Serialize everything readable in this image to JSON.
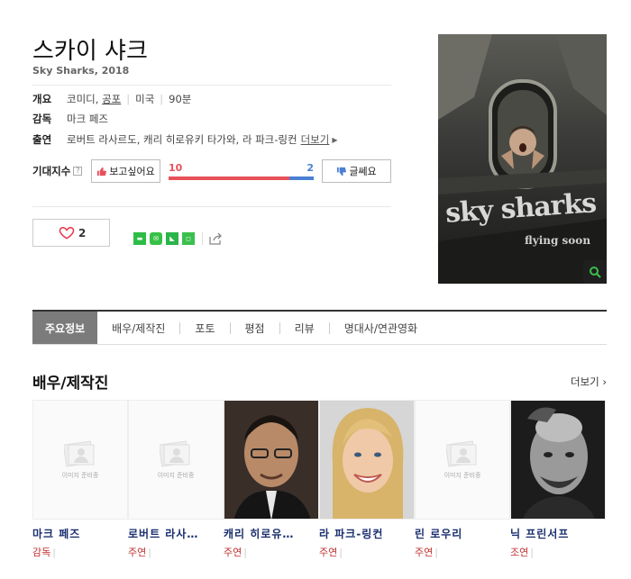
{
  "movie": {
    "title_ko": "스카이 샤크",
    "subtitle": "Sky Sharks, 2018"
  },
  "overview": {
    "label": "개요",
    "genres": [
      "코미디",
      "공포"
    ],
    "genre_sep": ",",
    "country": "미국",
    "runtime": "90분"
  },
  "director": {
    "label": "감독",
    "value": "마크 페즈"
  },
  "cast_line": {
    "label": "출연",
    "value": "로버트 라사르도, 캐리 히로유키 타가와, 라 파크-링컨",
    "more": "더보기"
  },
  "expectation": {
    "label": "기대지수",
    "help": "?",
    "want_label": "보고싶어요",
    "want_count": "10",
    "nah_label": "글쎄요",
    "nah_count": "2",
    "want_fraction": 0.833,
    "colors": {
      "want": "#e8505b",
      "nah": "#4a7fd4"
    }
  },
  "like": {
    "count": "2"
  },
  "share": {
    "icons": [
      "band-icon",
      "line-icon",
      "kakao-icon",
      "naver-icon",
      "share-icon"
    ]
  },
  "poster": {
    "title": "sky sharks",
    "tagline": "flying soon"
  },
  "tabs": [
    {
      "label": "주요정보",
      "active": true
    },
    {
      "label": "배우/제작진"
    },
    {
      "label": "포토"
    },
    {
      "label": "평점"
    },
    {
      "label": "리뷰"
    },
    {
      "label": "명대사/연관영화"
    }
  ],
  "section": {
    "title": "배우/제작진",
    "more": "더보기"
  },
  "people": [
    {
      "name": "마크 페즈",
      "role": "감독",
      "photo": "none"
    },
    {
      "name": "로버트 라사…",
      "role": "주연",
      "photo": "none"
    },
    {
      "name": "캐리 히로유…",
      "role": "주연",
      "photo": "man-glasses"
    },
    {
      "name": "라 파크-링컨",
      "role": "주연",
      "photo": "woman-blonde"
    },
    {
      "name": "린 로우리",
      "role": "주연",
      "photo": "none"
    },
    {
      "name": "닉 프린서프",
      "role": "조연",
      "photo": "man-bald"
    }
  ],
  "placeholder_text": "이미지 준비중"
}
